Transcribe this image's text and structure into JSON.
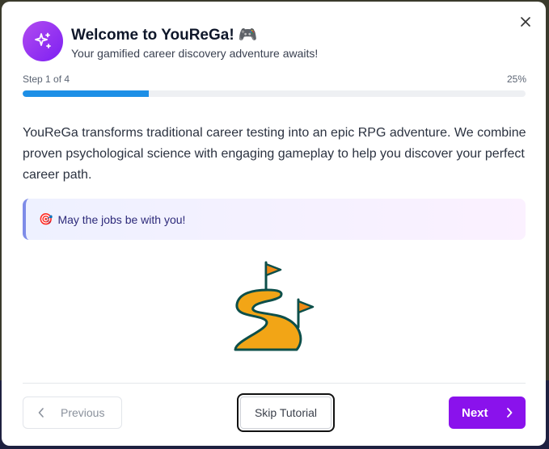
{
  "header": {
    "icon": "sparkles-icon",
    "title": "Welcome to YouReGa! 🎮",
    "subtitle": "Your gamified career discovery adventure awaits!",
    "close_icon": "close-icon"
  },
  "progress": {
    "step_label": "Step 1 of 4",
    "percent_label": "25%",
    "value": 0.25,
    "fill_color": "#1d8fe6"
  },
  "body": {
    "description": "YouReGa transforms traditional career testing into an epic RPG adventure. We combine proven psychological science with engaging gameplay to help you discover your perfect career path.",
    "callout": {
      "emoji": "🎯",
      "text": "May the jobs be with you!"
    },
    "illustration": "winding-path-with-flags-icon"
  },
  "footer": {
    "previous_label": "Previous",
    "skip_label": "Skip Tutorial",
    "next_label": "Next"
  },
  "colors": {
    "accent": "#8a12ec",
    "progress": "#1d8fe6",
    "path": "#f2a516",
    "flag": "#f08a14",
    "outline": "#0d4f4a"
  }
}
